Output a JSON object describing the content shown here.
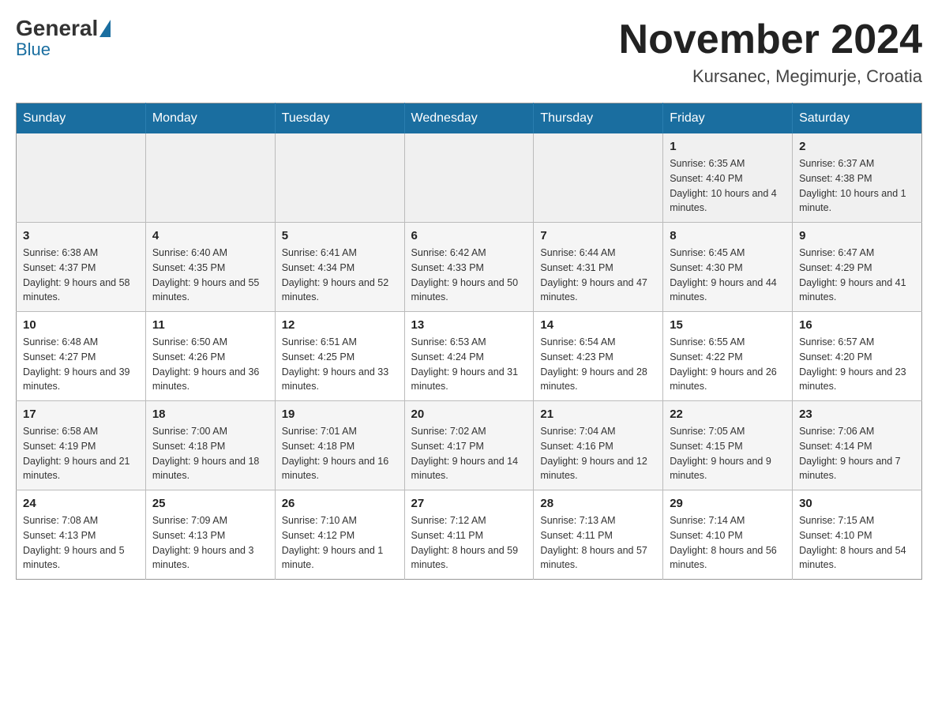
{
  "header": {
    "logo": {
      "general": "General",
      "blue": "Blue"
    },
    "title": "November 2024",
    "location": "Kursanec, Megimurje, Croatia"
  },
  "days_of_week": [
    "Sunday",
    "Monday",
    "Tuesday",
    "Wednesday",
    "Thursday",
    "Friday",
    "Saturday"
  ],
  "weeks": [
    [
      {
        "day": "",
        "info": ""
      },
      {
        "day": "",
        "info": ""
      },
      {
        "day": "",
        "info": ""
      },
      {
        "day": "",
        "info": ""
      },
      {
        "day": "",
        "info": ""
      },
      {
        "day": "1",
        "info": "Sunrise: 6:35 AM\nSunset: 4:40 PM\nDaylight: 10 hours and 4 minutes."
      },
      {
        "day": "2",
        "info": "Sunrise: 6:37 AM\nSunset: 4:38 PM\nDaylight: 10 hours and 1 minute."
      }
    ],
    [
      {
        "day": "3",
        "info": "Sunrise: 6:38 AM\nSunset: 4:37 PM\nDaylight: 9 hours and 58 minutes."
      },
      {
        "day": "4",
        "info": "Sunrise: 6:40 AM\nSunset: 4:35 PM\nDaylight: 9 hours and 55 minutes."
      },
      {
        "day": "5",
        "info": "Sunrise: 6:41 AM\nSunset: 4:34 PM\nDaylight: 9 hours and 52 minutes."
      },
      {
        "day": "6",
        "info": "Sunrise: 6:42 AM\nSunset: 4:33 PM\nDaylight: 9 hours and 50 minutes."
      },
      {
        "day": "7",
        "info": "Sunrise: 6:44 AM\nSunset: 4:31 PM\nDaylight: 9 hours and 47 minutes."
      },
      {
        "day": "8",
        "info": "Sunrise: 6:45 AM\nSunset: 4:30 PM\nDaylight: 9 hours and 44 minutes."
      },
      {
        "day": "9",
        "info": "Sunrise: 6:47 AM\nSunset: 4:29 PM\nDaylight: 9 hours and 41 minutes."
      }
    ],
    [
      {
        "day": "10",
        "info": "Sunrise: 6:48 AM\nSunset: 4:27 PM\nDaylight: 9 hours and 39 minutes."
      },
      {
        "day": "11",
        "info": "Sunrise: 6:50 AM\nSunset: 4:26 PM\nDaylight: 9 hours and 36 minutes."
      },
      {
        "day": "12",
        "info": "Sunrise: 6:51 AM\nSunset: 4:25 PM\nDaylight: 9 hours and 33 minutes."
      },
      {
        "day": "13",
        "info": "Sunrise: 6:53 AM\nSunset: 4:24 PM\nDaylight: 9 hours and 31 minutes."
      },
      {
        "day": "14",
        "info": "Sunrise: 6:54 AM\nSunset: 4:23 PM\nDaylight: 9 hours and 28 minutes."
      },
      {
        "day": "15",
        "info": "Sunrise: 6:55 AM\nSunset: 4:22 PM\nDaylight: 9 hours and 26 minutes."
      },
      {
        "day": "16",
        "info": "Sunrise: 6:57 AM\nSunset: 4:20 PM\nDaylight: 9 hours and 23 minutes."
      }
    ],
    [
      {
        "day": "17",
        "info": "Sunrise: 6:58 AM\nSunset: 4:19 PM\nDaylight: 9 hours and 21 minutes."
      },
      {
        "day": "18",
        "info": "Sunrise: 7:00 AM\nSunset: 4:18 PM\nDaylight: 9 hours and 18 minutes."
      },
      {
        "day": "19",
        "info": "Sunrise: 7:01 AM\nSunset: 4:18 PM\nDaylight: 9 hours and 16 minutes."
      },
      {
        "day": "20",
        "info": "Sunrise: 7:02 AM\nSunset: 4:17 PM\nDaylight: 9 hours and 14 minutes."
      },
      {
        "day": "21",
        "info": "Sunrise: 7:04 AM\nSunset: 4:16 PM\nDaylight: 9 hours and 12 minutes."
      },
      {
        "day": "22",
        "info": "Sunrise: 7:05 AM\nSunset: 4:15 PM\nDaylight: 9 hours and 9 minutes."
      },
      {
        "day": "23",
        "info": "Sunrise: 7:06 AM\nSunset: 4:14 PM\nDaylight: 9 hours and 7 minutes."
      }
    ],
    [
      {
        "day": "24",
        "info": "Sunrise: 7:08 AM\nSunset: 4:13 PM\nDaylight: 9 hours and 5 minutes."
      },
      {
        "day": "25",
        "info": "Sunrise: 7:09 AM\nSunset: 4:13 PM\nDaylight: 9 hours and 3 minutes."
      },
      {
        "day": "26",
        "info": "Sunrise: 7:10 AM\nSunset: 4:12 PM\nDaylight: 9 hours and 1 minute."
      },
      {
        "day": "27",
        "info": "Sunrise: 7:12 AM\nSunset: 4:11 PM\nDaylight: 8 hours and 59 minutes."
      },
      {
        "day": "28",
        "info": "Sunrise: 7:13 AM\nSunset: 4:11 PM\nDaylight: 8 hours and 57 minutes."
      },
      {
        "day": "29",
        "info": "Sunrise: 7:14 AM\nSunset: 4:10 PM\nDaylight: 8 hours and 56 minutes."
      },
      {
        "day": "30",
        "info": "Sunrise: 7:15 AM\nSunset: 4:10 PM\nDaylight: 8 hours and 54 minutes."
      }
    ]
  ]
}
